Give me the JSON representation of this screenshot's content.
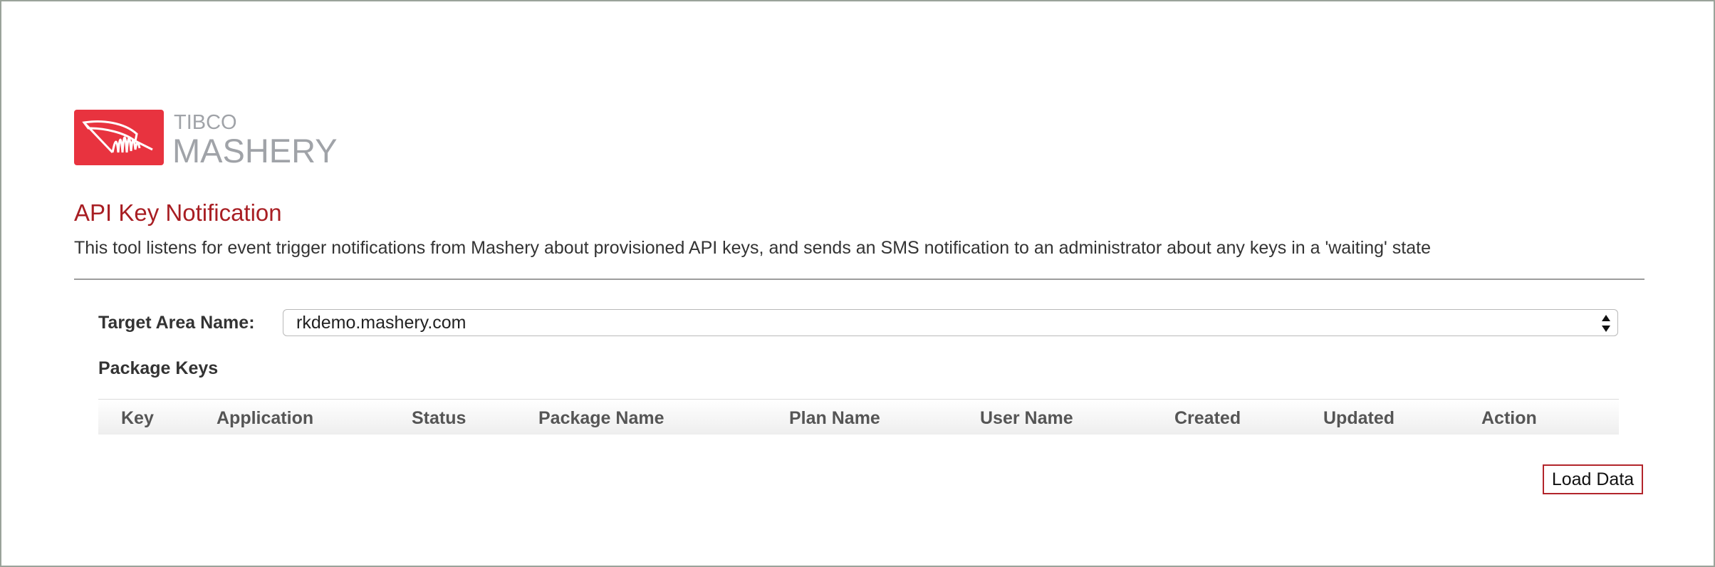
{
  "brand": {
    "small": "TIBCO",
    "big": "MASHERY",
    "badge_color": "#e8333f",
    "text_color": "#a0a3a8"
  },
  "page": {
    "title": "API Key Notification",
    "description": "This tool listens for event trigger notifications from Mashery about provisioned API keys, and sends an SMS notification to an administrator about any keys in a 'waiting' state",
    "title_color": "#a81e23"
  },
  "form": {
    "target_label": "Target Area Name:",
    "target_value": "rkdemo.mashery.com"
  },
  "package_keys": {
    "label": "Package Keys",
    "columns": [
      "Key",
      "Application",
      "Status",
      "Package Name",
      "Plan Name",
      "User Name",
      "Created",
      "Updated",
      "Action"
    ],
    "rows": []
  },
  "actions": {
    "load_data": "Load Data",
    "button_border_color": "#b2252b"
  }
}
